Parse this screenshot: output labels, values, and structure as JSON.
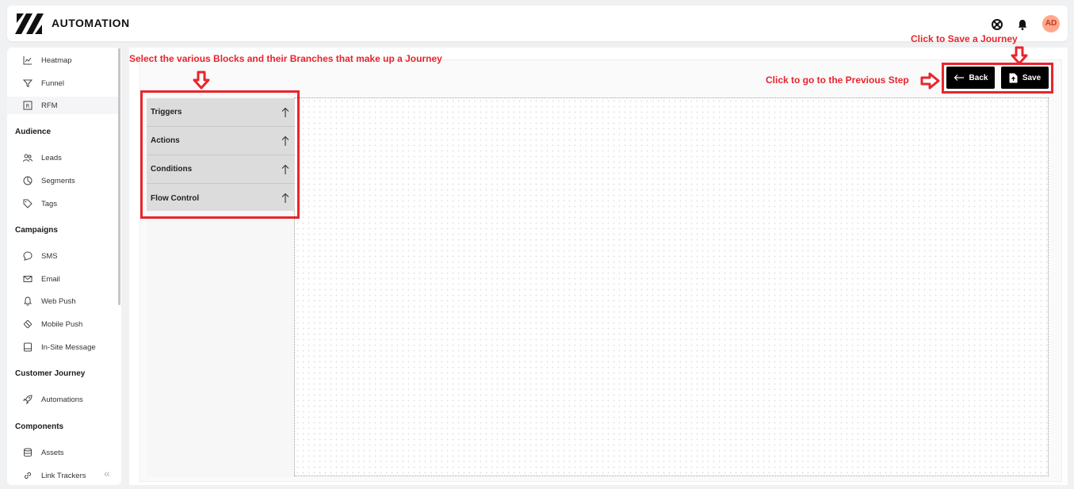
{
  "header": {
    "title": "AUTOMATION",
    "avatar_initials": "AD",
    "icons": [
      "support-icon",
      "bell-icon"
    ]
  },
  "sidebar": {
    "items_top": [
      {
        "label": "Heatmap",
        "icon": "heatmap-icon"
      },
      {
        "label": "Funnel",
        "icon": "funnel-icon"
      },
      {
        "label": "RFM",
        "icon": "rfm-icon"
      }
    ],
    "sections": [
      {
        "title": "Audience",
        "items": [
          {
            "label": "Leads",
            "icon": "users-icon"
          },
          {
            "label": "Segments",
            "icon": "pie-icon"
          },
          {
            "label": "Tags",
            "icon": "tag-icon"
          }
        ]
      },
      {
        "title": "Campaigns",
        "items": [
          {
            "label": "SMS",
            "icon": "chat-icon"
          },
          {
            "label": "Email",
            "icon": "mail-icon"
          },
          {
            "label": "Web Push",
            "icon": "bell-icon"
          },
          {
            "label": "Mobile Push",
            "icon": "mobile-push-icon"
          },
          {
            "label": "In-Site Message",
            "icon": "message-icon"
          }
        ]
      },
      {
        "title": "Customer Journey",
        "items": [
          {
            "label": "Automations",
            "icon": "rocket-icon"
          }
        ]
      },
      {
        "title": "Components",
        "items": [
          {
            "label": "Assets",
            "icon": "database-icon"
          },
          {
            "label": "Link Trackers",
            "icon": "link-icon"
          }
        ]
      }
    ]
  },
  "toolbar": {
    "back_label": "Back",
    "save_label": "Save"
  },
  "blocks": [
    {
      "label": "Triggers"
    },
    {
      "label": "Actions"
    },
    {
      "label": "Conditions"
    },
    {
      "label": "Flow Control"
    }
  ],
  "annotations": {
    "blocks_note": "Select the various Blocks and their Branches that make up a Journey",
    "save_note": "Click to Save a Journey",
    "back_note": "Click to go to the Previous Step",
    "color": "#e8252c"
  }
}
